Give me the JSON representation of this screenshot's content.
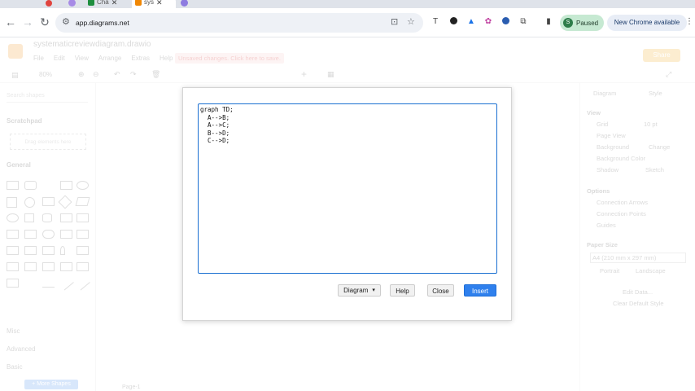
{
  "browser": {
    "tabs": [
      {
        "label": "Cha",
        "favicon_color": "#1e8e3e"
      },
      {
        "label": "sys",
        "favicon_color": "#f08705"
      }
    ],
    "url": "app.diagrams.net",
    "profile_label": "Paused",
    "profile_initial": "S",
    "update_label": "New Chrome available",
    "icons": {
      "back": "arrow-left-icon",
      "forward": "arrow-right-icon",
      "reload": "reload-icon",
      "site_info": "tune-icon",
      "install": "install-icon",
      "bookmark": "star-icon",
      "more": "kebab-icon"
    }
  },
  "app": {
    "file_title": "systematicreviewdiagram.drawio",
    "menu": [
      "File",
      "Edit",
      "View",
      "Arrange",
      "Extras",
      "Help"
    ],
    "unsaved_notice": "Unsaved changes. Click here to save.",
    "share_label": "Share",
    "zoom": "80%",
    "left_panel": {
      "search_placeholder": "Search shapes",
      "sections": [
        "Scratchpad",
        "General",
        "Misc",
        "Advanced",
        "Basic"
      ],
      "drag_hint": "Drag elements here",
      "more_shapes": "+ More Shapes"
    },
    "right_panel": {
      "tabs": [
        "Diagram",
        "Style"
      ],
      "sections": [
        "View",
        "Options",
        "Paper Size"
      ],
      "grid": "Grid",
      "grid_size": "10 pt",
      "page_view": "Page View",
      "background": "Background",
      "change": "Change",
      "background_color": "Background Color",
      "shadow": "Shadow",
      "sketch": "Sketch",
      "connection_arrows": "Connection Arrows",
      "connection_points": "Connection Points",
      "guides": "Guides",
      "paper": "A4 (210 mm x 297 mm)",
      "portrait": "Portrait",
      "landscape": "Landscape",
      "edit_data": "Edit Data...",
      "clear_default_style": "Clear Default Style"
    },
    "page_tab": "Page-1"
  },
  "dialog": {
    "code": "graph TD;\n  A-->B;\n  A-->C;\n  B-->D;\n  C-->D;",
    "diagram_select": "Diagram",
    "help": "Help",
    "close": "Close",
    "insert": "Insert",
    "insert_color": "#2f80ed",
    "focus_color": "#1a6fd1"
  }
}
